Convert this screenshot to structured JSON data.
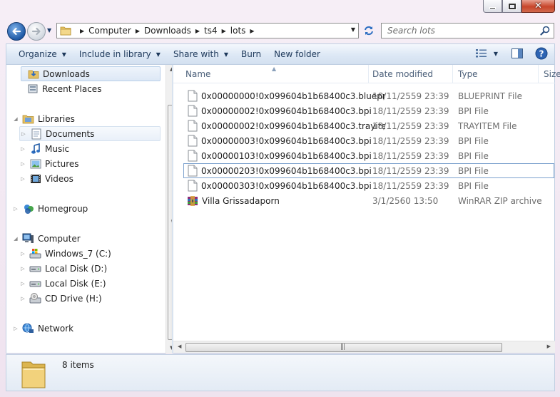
{
  "window": {
    "minimize_label": "—",
    "maximize_label": "□",
    "close_label": "✕"
  },
  "address": {
    "crumbs": [
      "Computer",
      "Downloads",
      "ts4",
      "lots"
    ]
  },
  "search": {
    "placeholder": "Search lots"
  },
  "toolbar": {
    "organize": "Organize",
    "include_in_library": "Include in library",
    "share_with": "Share with",
    "burn": "Burn",
    "new_folder": "New folder"
  },
  "nav": {
    "favorites": {
      "downloads": "Downloads",
      "recent_places": "Recent Places"
    },
    "libraries": {
      "label": "Libraries",
      "documents": "Documents",
      "music": "Music",
      "pictures": "Pictures",
      "videos": "Videos"
    },
    "homegroup": "Homegroup",
    "computer": {
      "label": "Computer",
      "drives": [
        "Windows_7 (C:)",
        "Local Disk (D:)",
        "Local Disk (E:)",
        "CD Drive (H:)"
      ]
    },
    "network": "Network"
  },
  "columns": {
    "name": "Name",
    "date_modified": "Date modified",
    "type": "Type",
    "size": "Size"
  },
  "files": [
    {
      "name": "0x00000000!0x099604b1b68400c3.blueprint",
      "date": "18/11/2559 23:39",
      "type": "BLUEPRINT File"
    },
    {
      "name": "0x00000002!0x099604b1b68400c3.bpi",
      "date": "18/11/2559 23:39",
      "type": "BPI File"
    },
    {
      "name": "0x00000002!0x099604b1b68400c3.trayitem",
      "date": "18/11/2559 23:39",
      "type": "TRAYITEM File"
    },
    {
      "name": "0x00000003!0x099604b1b68400c3.bpi",
      "date": "18/11/2559 23:39",
      "type": "BPI File"
    },
    {
      "name": "0x00000103!0x099604b1b68400c3.bpi",
      "date": "18/11/2559 23:39",
      "type": "BPI File"
    },
    {
      "name": "0x00000203!0x099604b1b68400c3.bpi",
      "date": "18/11/2559 23:39",
      "type": "BPI File"
    },
    {
      "name": "0x00000303!0x099604b1b68400c3.bpi",
      "date": "18/11/2559 23:39",
      "type": "BPI File"
    },
    {
      "name": "Villa Grissadaporn",
      "date": "3/1/2560 13:50",
      "type": "WinRAR ZIP archive"
    }
  ],
  "status": {
    "item_count": "8 items"
  }
}
